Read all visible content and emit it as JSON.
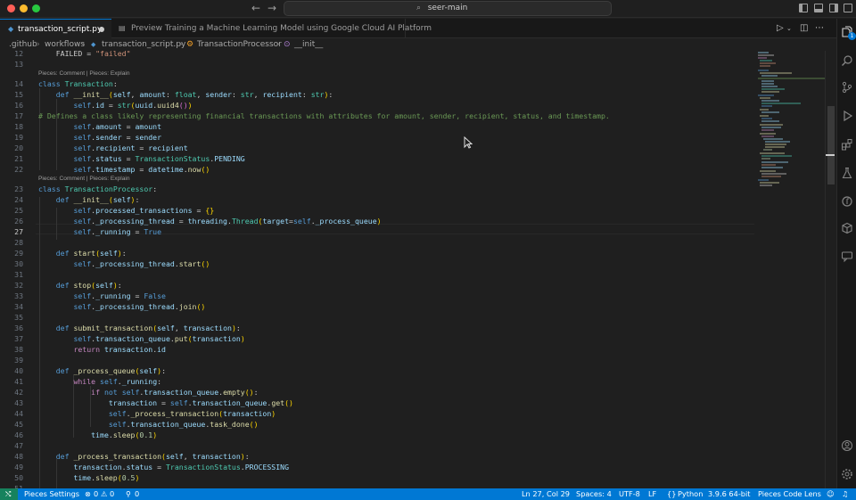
{
  "window": {
    "search_text": "seer-main"
  },
  "tabs": [
    {
      "label": "transaction_script.py",
      "modified": true
    },
    {
      "label": "Preview Training a Machine Learning Model using Google Cloud AI Platform"
    }
  ],
  "breadcrumb": [
    ".github",
    "workflows",
    "transaction_script.py",
    "TransactionProcessor",
    "__init__"
  ],
  "lens_text": "Pieces: Comment | Pieces: Explain",
  "code_lines": [
    {
      "n": "12",
      "text": "    FAILED = \"failed\""
    },
    {
      "n": "13",
      "text": ""
    },
    {
      "n": "14",
      "text": "class Transaction:"
    },
    {
      "n": "15",
      "text": "    def __init__(self, amount: float, sender: str, recipient: str):"
    },
    {
      "n": "16",
      "text": "        self.id = str(uuid.uuid4())"
    },
    {
      "n": "17",
      "text": "# Defines a class likely representing financial transactions with attributes for amount, sender, recipient, status, and timestamp."
    },
    {
      "n": "18",
      "text": "        self.amount = amount"
    },
    {
      "n": "19",
      "text": "        self.sender = sender"
    },
    {
      "n": "20",
      "text": "        self.recipient = recipient"
    },
    {
      "n": "21",
      "text": "        self.status = TransactionStatus.PENDING"
    },
    {
      "n": "22",
      "text": "        self.timestamp = datetime.now()"
    },
    {
      "n": "23",
      "text": "class TransactionProcessor:"
    },
    {
      "n": "24",
      "text": "    def __init__(self):"
    },
    {
      "n": "25",
      "text": "        self.processed_transactions = {}"
    },
    {
      "n": "26",
      "text": "        self._processing_thread = threading.Thread(target=self._process_queue)"
    },
    {
      "n": "27",
      "text": "        self._running = True"
    },
    {
      "n": "28",
      "text": ""
    },
    {
      "n": "29",
      "text": "    def start(self):"
    },
    {
      "n": "30",
      "text": "        self._processing_thread.start()"
    },
    {
      "n": "31",
      "text": ""
    },
    {
      "n": "32",
      "text": "    def stop(self):"
    },
    {
      "n": "33",
      "text": "        self._running = False"
    },
    {
      "n": "34",
      "text": "        self._processing_thread.join()"
    },
    {
      "n": "35",
      "text": ""
    },
    {
      "n": "36",
      "text": "    def submit_transaction(self, transaction):"
    },
    {
      "n": "37",
      "text": "        self.transaction_queue.put(transaction)"
    },
    {
      "n": "38",
      "text": "        return transaction.id"
    },
    {
      "n": "39",
      "text": ""
    },
    {
      "n": "40",
      "text": "    def _process_queue(self):"
    },
    {
      "n": "41",
      "text": "        while self._running:"
    },
    {
      "n": "42",
      "text": "            if not self.transaction_queue.empty():"
    },
    {
      "n": "43",
      "text": "                transaction = self.transaction_queue.get()"
    },
    {
      "n": "44",
      "text": "                self._process_transaction(transaction)"
    },
    {
      "n": "45",
      "text": "                self.transaction_queue.task_done()"
    },
    {
      "n": "46",
      "text": "            time.sleep(0.1)"
    },
    {
      "n": "47",
      "text": ""
    },
    {
      "n": "48",
      "text": "    def _process_transaction(self, transaction):"
    },
    {
      "n": "49",
      "text": "        transaction.status = TransactionStatus.PROCESSING"
    },
    {
      "n": "50",
      "text": "        time.sleep(0.5)"
    },
    {
      "n": "51",
      "text": ""
    }
  ],
  "current_line": "27",
  "status": {
    "pieces_settings": "Pieces Settings",
    "errors": "0",
    "warnings": "0",
    "ports": "0",
    "cursor": "Ln 27, Col 29",
    "spaces": "Spaces: 4",
    "encoding": "UTF-8",
    "eol": "LF",
    "language": "Python",
    "interpreter": "3.9.6 64-bit",
    "code_lens": "Pieces Code Lens"
  },
  "activity_badge": "1",
  "colors": {
    "accent": "#0078d4",
    "remote": "#16825d",
    "background": "#1f1f1f"
  }
}
